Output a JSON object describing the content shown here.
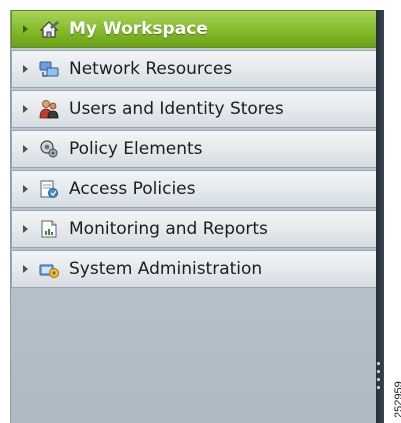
{
  "nav": {
    "items": [
      {
        "label": "My Workspace",
        "icon": "workspace-icon",
        "active": true
      },
      {
        "label": "Network Resources",
        "icon": "network-resources-icon",
        "active": false
      },
      {
        "label": "Users and Identity Stores",
        "icon": "users-icon",
        "active": false
      },
      {
        "label": "Policy Elements",
        "icon": "policy-elements-icon",
        "active": false
      },
      {
        "label": "Access Policies",
        "icon": "access-policies-icon",
        "active": false
      },
      {
        "label": "Monitoring and Reports",
        "icon": "monitoring-reports-icon",
        "active": false
      },
      {
        "label": "System Administration",
        "icon": "system-administration-icon",
        "active": false
      }
    ]
  },
  "figure_number": "252959",
  "colors": {
    "active_item": "#86bd2d",
    "inactive_item": "#e4e8ec",
    "panel_background": "#b7c2cb",
    "scrollbar": "#2f3945"
  }
}
